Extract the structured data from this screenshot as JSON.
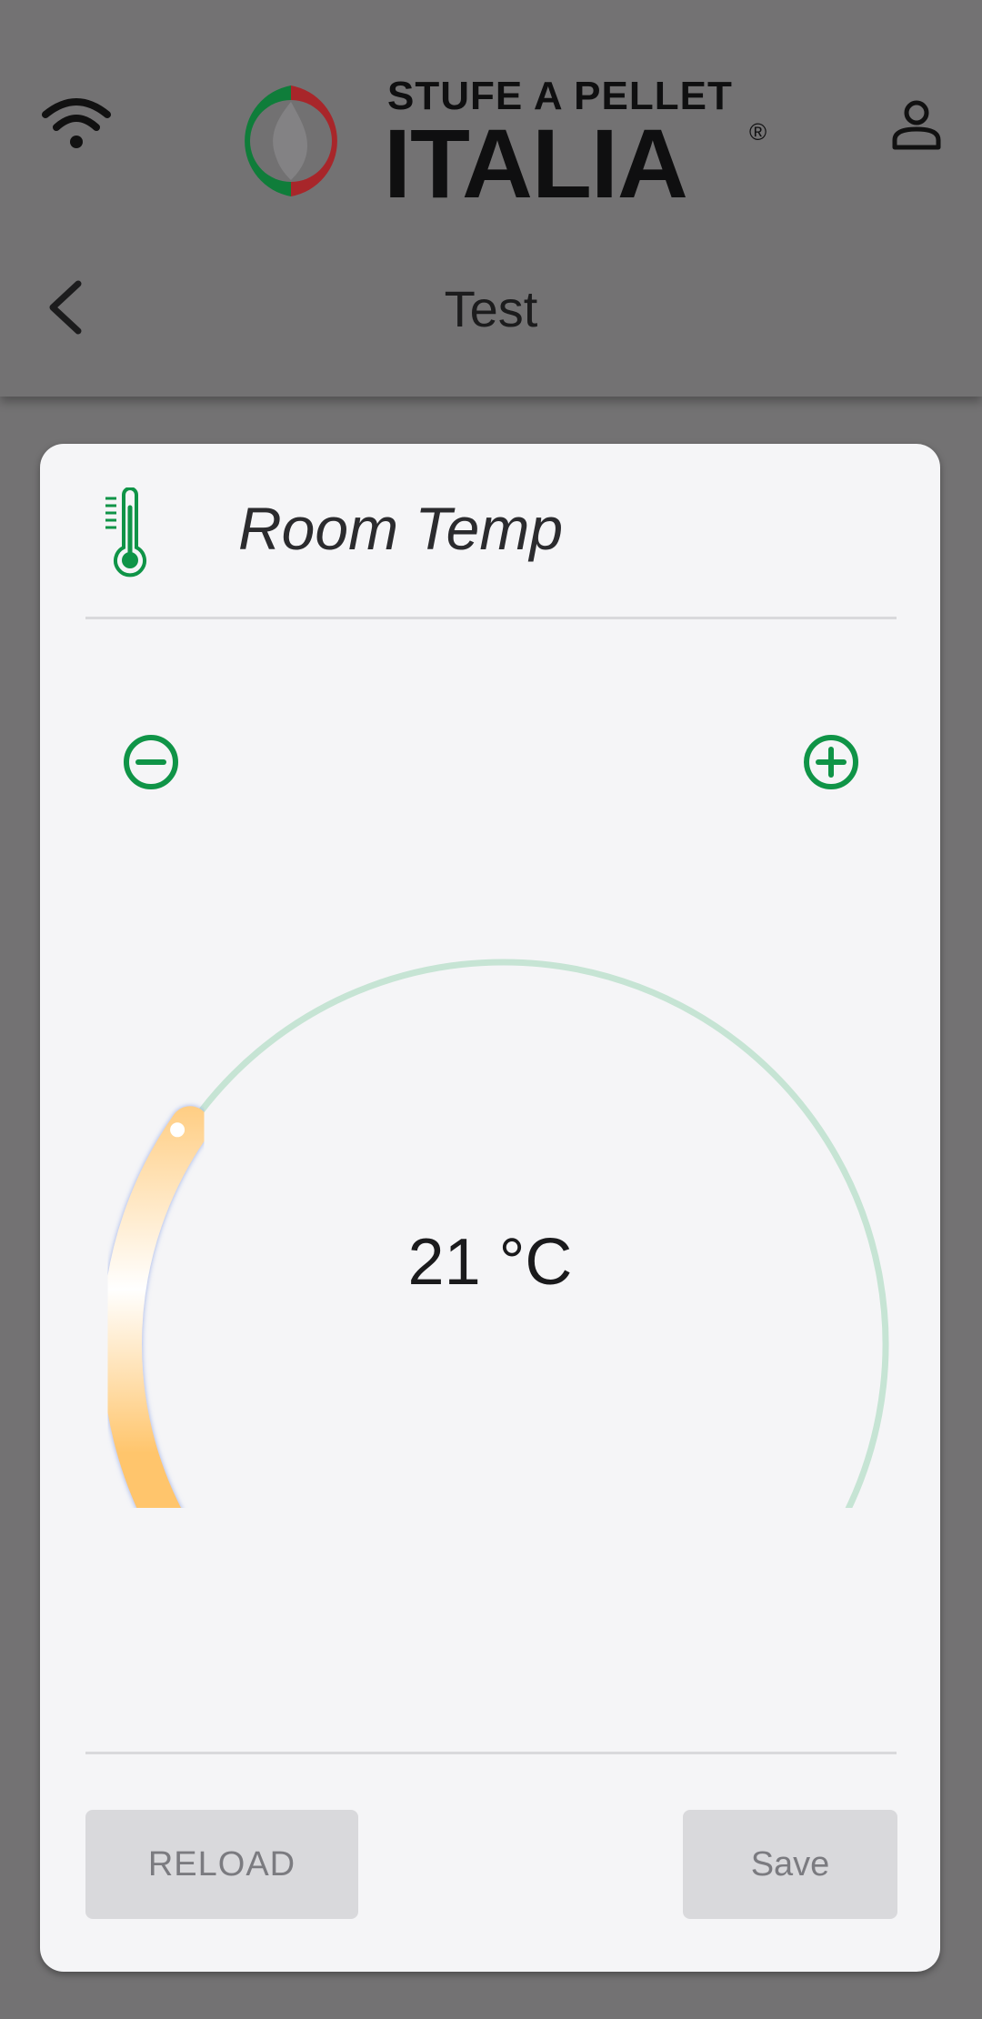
{
  "header": {
    "logo": {
      "line1": "STUFE A PELLET",
      "line2": "ITALIA",
      "mark": "®"
    },
    "page_title": "Test",
    "icons": {
      "left": "wifi-icon",
      "right": "user-icon",
      "back": "chevron-left-icon"
    }
  },
  "card": {
    "title": "Room Temp",
    "title_icon": "thermometer-icon",
    "controls": {
      "decrease": "minus-circle-icon",
      "increase": "plus-circle-icon"
    },
    "dial": {
      "value": 21,
      "display": "21 °C",
      "fraction": 0.27,
      "track_color": "#c6e4d4",
      "fill_color": "#ffc266",
      "accent": "#0f9447"
    },
    "buttons": {
      "reload": "RELOAD",
      "save": "Save"
    }
  }
}
